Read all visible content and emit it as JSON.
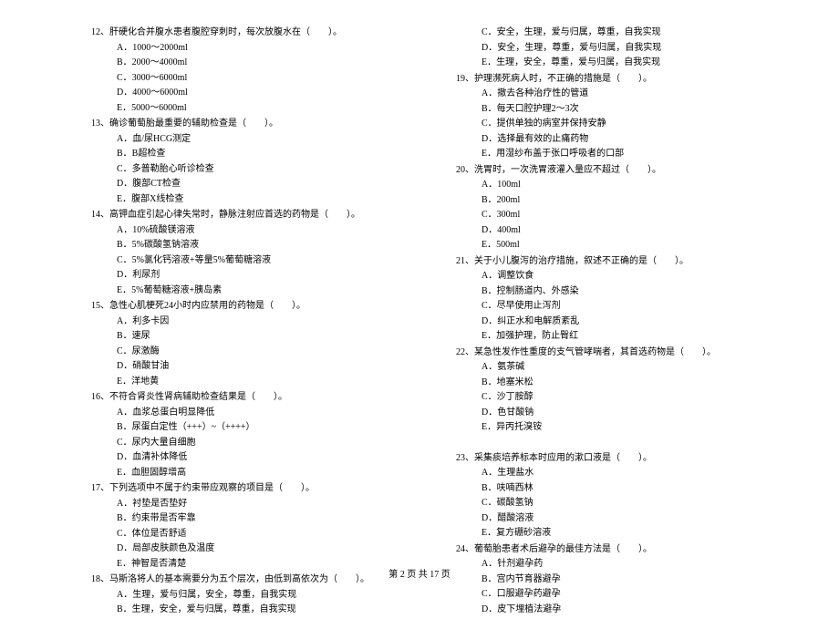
{
  "left": {
    "q12": {
      "stem": "12、肝硬化合并腹水患者腹腔穿刺时，每次放腹水在（　　）。",
      "a": "A．1000～2000ml",
      "b": "B．2000～4000ml",
      "c": "C．3000～6000ml",
      "d": "D．4000～6000ml",
      "e": "E．5000～6000ml"
    },
    "q13": {
      "stem": "13、确诊葡萄胎最重要的辅助检查是（　　）。",
      "a": "A．血/尿HCG测定",
      "b": "B．B超检查",
      "c": "C．多普勒胎心听诊检查",
      "d": "D．腹部CT检查",
      "e": "E．腹部X线检查"
    },
    "q14": {
      "stem": "14、高钾血症引起心律失常时，静脉注射应首选的药物是（　　）。",
      "a": "A．10%硫酸镁溶液",
      "b": "B．5%碳酸氢钠溶液",
      "c": "C．5%氯化钙溶液+等量5%葡萄糖溶液",
      "d": "D．利尿剂",
      "e": "E．5%葡萄糖溶液+胰岛素"
    },
    "q15": {
      "stem": "15、急性心肌梗死24小时内应禁用的药物是（　　）。",
      "a": "A．利多卡因",
      "b": "B．速尿",
      "c": "C．尿激酶",
      "d": "D．硝酸甘油",
      "e": "E．洋地黄"
    },
    "q16": {
      "stem": "16、不符合肾炎性肾病辅助检查结果是（　　）。",
      "a": "A．血浆总蛋白明显降低",
      "b": "B．尿蛋白定性（+++）~（++++）",
      "c": "C．尿内大量自细胞",
      "d": "D．血清补体降低",
      "e": "E．血胆固醇增高"
    },
    "q17": {
      "stem": "17、下列选项中不属于约束带应观察的项目是（　　）。",
      "a": "A．衬垫是否垫好",
      "b": "B．约束带是否牢靠",
      "c": "C．体位是否舒适",
      "d": "D．局部皮肤颜色及温度",
      "e": "E．神智是否清楚"
    },
    "q18": {
      "stem": "18、马斯洛将人的基本需要分为五个层次，由低到高依次为（　　）。",
      "a": "A．生理，爱与归属，安全，尊重，自我实现",
      "b": "B．生理，安全，爱与归属，尊重，自我实现"
    }
  },
  "right": {
    "q18": {
      "c": "C．安全，生理，爱与归属，尊重，自我实现",
      "d": "D．安全，生理，尊重，爱与归属，自我实现",
      "e": "E．生理，安全，尊重，爱与归属，自我实现"
    },
    "q19": {
      "stem": "19、护理濒死病人时，不正确的措施是（　　）。",
      "a": "A．撤去各种治疗性的管道",
      "b": "B．每天口腔护理2～3次",
      "c": "C．提供单独的病室并保持安静",
      "d": "D．选择最有效的止痛药物",
      "e": "E．用湿纱布盖于张口呼吸者的口部"
    },
    "q20": {
      "stem": "20、洗胃时，一次洗胃液灌入量应不超过（　　）。",
      "a": "A．100ml",
      "b": "B．200ml",
      "c": "C．300ml",
      "d": "D．400ml",
      "e": "E．500ml"
    },
    "q21": {
      "stem": "21、关于小儿腹泻的治疗措施，叙述不正确的是（　　）。",
      "a": "A．调整饮食",
      "b": "B．控制肠道内、外感染",
      "c": "C．尽早使用止泻剂",
      "d": "D．纠正水和电解质紊乱",
      "e": "E．加强护理，防止臀红"
    },
    "q22": {
      "stem": "22、某急性发作性重度的支气管哮喘者，其首选药物是（　　）。",
      "a": "A．氨茶碱",
      "b": "B．地塞米松",
      "c": "C．沙丁胺醇",
      "d": "D．色甘酸钠",
      "e": "E．异丙托溴铵"
    },
    "q23": {
      "stem": "23、采集痰培养标本时应用的漱口液是（　　）。",
      "a": "A．生理盐水",
      "b": "B．呋喃西林",
      "c": "C．碳酸氢钠",
      "d": "D．醋酸溶液",
      "e": "E．复方硼砂溶液"
    },
    "q24": {
      "stem": "24、葡萄胎患者术后避孕的最佳方法是（　　）。",
      "a": "A．针剂避孕药",
      "b": "B．宫内节育器避孕",
      "c": "C．口服避孕药避孕",
      "d": "D．皮下埋植法避孕"
    }
  },
  "footer": "第 2 页 共 17 页"
}
